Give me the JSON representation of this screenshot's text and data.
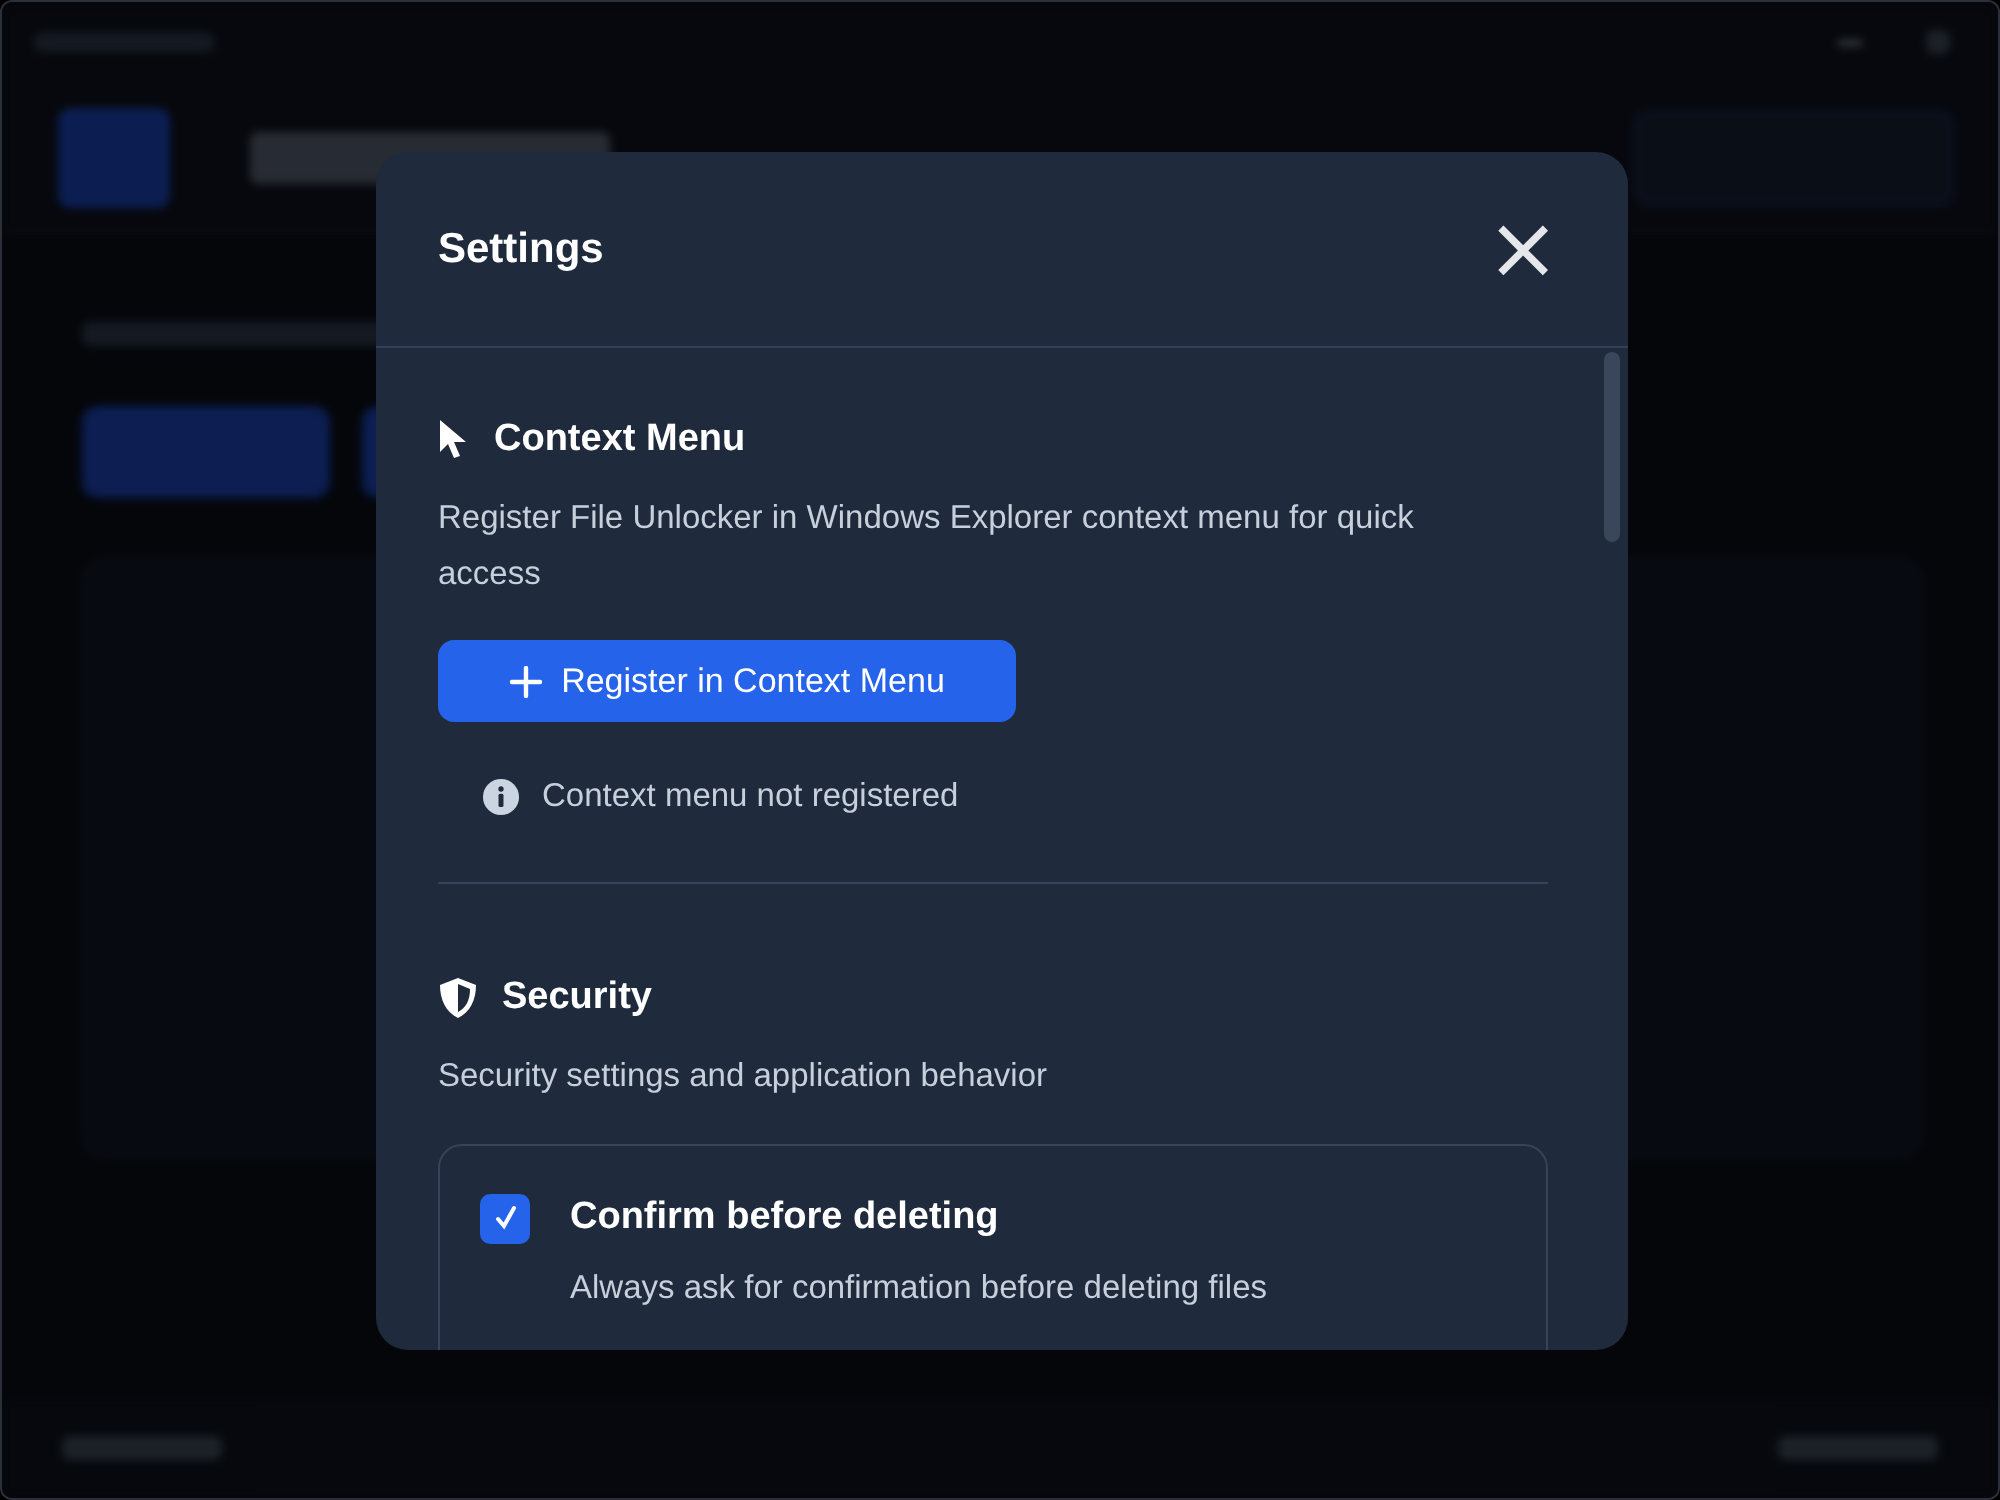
{
  "dialog": {
    "title": "Settings",
    "close": "×",
    "sections": [
      {
        "kind": "context",
        "title": "Context Menu",
        "description": "Register File Unlocker in Windows Explorer context menu for quick access",
        "button": "Register in Context Menu",
        "status": "Context menu not registered"
      },
      {
        "kind": "security",
        "title": "Security",
        "description": "Security settings and application behavior",
        "options": [
          {
            "label": "Confirm before deleting",
            "description": "Always ask for confirmation before deleting files",
            "checked": true
          }
        ]
      }
    ]
  }
}
